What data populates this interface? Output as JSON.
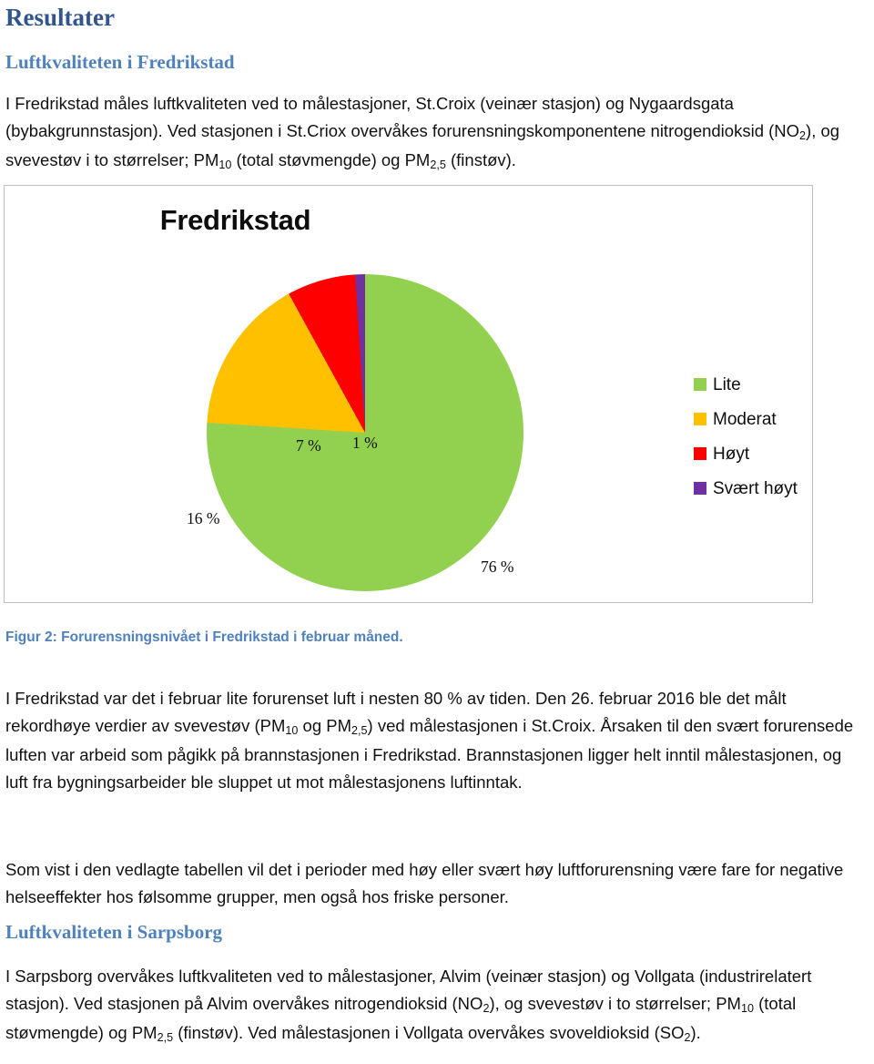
{
  "document": {
    "title": "Resultater"
  },
  "sections": {
    "fredrikstad": {
      "heading": "Luftkvaliteten i Fredrikstad",
      "intro_paragraph": {
        "part1": "I Fredrikstad måles luftkvaliteten ved to målestasjoner, St.Croix (veinær stasjon) og Nygaardsgata (bybakgrunnstasjon). Ved stasjonen i St.Criox overvåkes forurensningskomponentene nitrogendioksid (NO",
        "sub1": "2",
        "part2": "), og svevestøv i to størrelser; PM",
        "sub2": "10",
        "part3": " (total støvmengde) og PM",
        "sub3": "2,5",
        "part4": " (finstøv)."
      },
      "figure_caption": "Figur 2: Forurensningsnivået i Fredrikstad i februar måned.",
      "analysis_paragraph": {
        "part1": "I Fredrikstad var det i februar lite forurenset luft i nesten 80 % av tiden. Den 26. februar 2016 ble det målt rekordhøye verdier av svevestøv (PM",
        "sub1": "10",
        "part2": " og PM",
        "sub2": "2,5",
        "part3": ") ved målestasjonen i St.Croix. Årsaken til den svært forurensede luften var arbeid som pågikk på brannstasjonen i Fredrikstad. Brannstasjonen ligger helt inntil målestasjonen, og luft fra bygningsarbeider ble sluppet ut mot målestasjonens luftinntak."
      },
      "table_paragraph": "Som vist i den vedlagte tabellen vil det i perioder med høy eller svært høy luftforurensning være fare for negative helseeffekter hos følsomme grupper, men også hos friske personer."
    },
    "sarpsborg": {
      "heading": "Luftkvaliteten i Sarpsborg",
      "intro_paragraph": {
        "part1": "I Sarpsborg overvåkes luftkvaliteten ved to målestasjoner, Alvim (veinær stasjon) og Vollgata (industrirelatert stasjon). Ved stasjonen på Alvim overvåkes nitrogendioksid (NO",
        "sub1": "2",
        "part2": "), og svevestøv i to størrelser; PM",
        "sub2": "10",
        "part3": " (total støvmengde) og PM",
        "sub3": "2,5",
        "part4": " (finstøv). Ved målestasjonen i Vollgata overvåkes svoveldioksid (SO",
        "sub4": "2",
        "part5": ")."
      }
    }
  },
  "chart_data": {
    "type": "pie",
    "title": "Fredrikstad",
    "categories": [
      "Lite",
      "Moderat",
      "Høyt",
      "Svært høyt"
    ],
    "values": [
      76,
      16,
      7,
      1
    ],
    "value_labels": [
      "76 %",
      "16 %",
      "7 %",
      "1 %"
    ],
    "colors": [
      "#92D050",
      "#FFC000",
      "#FF0000",
      "#7030A0"
    ],
    "legend_position": "right",
    "start_angle_deg": 0,
    "grid": false,
    "xlabel": "",
    "ylabel": ""
  }
}
